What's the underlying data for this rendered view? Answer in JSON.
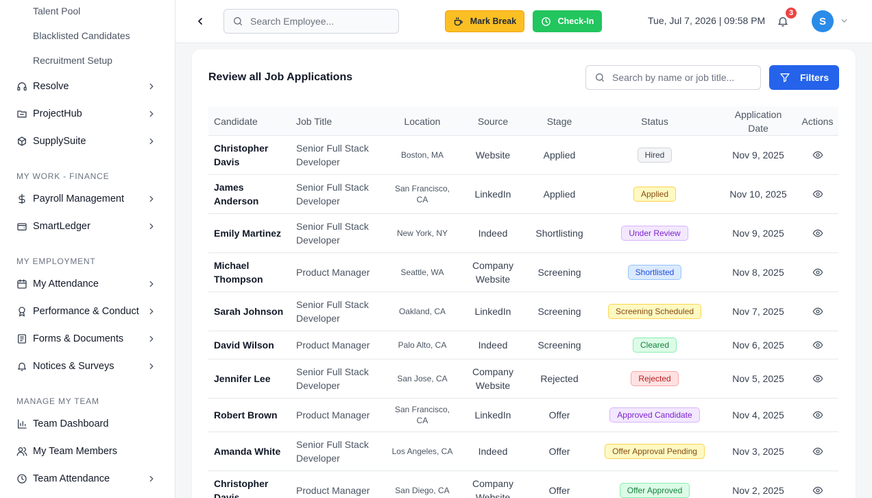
{
  "sidebar": {
    "sub_items": [
      "Talent Pool",
      "Blacklisted Candidates",
      "Recruitment Setup"
    ],
    "groups": [
      {
        "label": "Resolve",
        "icon": "headset-icon"
      },
      {
        "label": "ProjectHub",
        "icon": "folder-icon"
      },
      {
        "label": "SupplySuite",
        "icon": "box-icon"
      }
    ],
    "sections": [
      {
        "title": "MY WORK - FINANCE",
        "items": [
          {
            "label": "Payroll Management",
            "icon": "dollar-icon"
          },
          {
            "label": "SmartLedger",
            "icon": "wallet-icon"
          }
        ]
      },
      {
        "title": "MY EMPLOYMENT",
        "items": [
          {
            "label": "My Attendance",
            "icon": "calendar-icon"
          },
          {
            "label": "Performance & Conduct",
            "icon": "award-icon"
          },
          {
            "label": "Forms & Documents",
            "icon": "document-icon"
          },
          {
            "label": "Notices & Surveys",
            "icon": "bell-icon"
          }
        ]
      },
      {
        "title": "MANAGE MY TEAM",
        "items": [
          {
            "label": "Team Dashboard",
            "icon": "bar-chart-icon"
          },
          {
            "label": "My Team Members",
            "icon": "users-icon"
          },
          {
            "label": "Team Attendance",
            "icon": "clock-icon"
          }
        ]
      }
    ]
  },
  "topbar": {
    "search_placeholder": "Search Employee...",
    "mark_break_label": "Mark Break",
    "check_in_label": "Check-In",
    "datetime": "Tue, Jul 7, 2026 | 09:58 PM",
    "notification_count": "3",
    "avatar_initial": "S"
  },
  "main": {
    "title": "Review all Job Applications",
    "search_placeholder": "Search by name or job title...",
    "filters_label": "Filters",
    "columns": {
      "candidate": "Candidate",
      "job_title": "Job Title",
      "location": "Location",
      "source": "Source",
      "stage": "Stage",
      "status": "Status",
      "application_date": "Application Date",
      "actions": "Actions"
    },
    "rows": [
      {
        "candidate": "Christopher Davis",
        "job_title": "Senior Full Stack Developer",
        "location": "Boston, MA",
        "source": "Website",
        "stage": "Applied",
        "status": "Hired",
        "status_color": "gray",
        "date": "Nov 9, 2025"
      },
      {
        "candidate": "James Anderson",
        "job_title": "Senior Full Stack Developer",
        "location": "San Francisco, CA",
        "source": "LinkedIn",
        "stage": "Applied",
        "status": "Applied",
        "status_color": "yellow",
        "date": "Nov 10, 2025"
      },
      {
        "candidate": "Emily Martinez",
        "job_title": "Senior Full Stack Developer",
        "location": "New York, NY",
        "source": "Indeed",
        "stage": "Shortlisting",
        "status": "Under Review",
        "status_color": "purple",
        "date": "Nov 9, 2025"
      },
      {
        "candidate": "Michael Thompson",
        "job_title": "Product Manager",
        "location": "Seattle, WA",
        "source": "Company Website",
        "stage": "Screening",
        "status": "Shortlisted",
        "status_color": "blue",
        "date": "Nov 8, 2025"
      },
      {
        "candidate": "Sarah Johnson",
        "job_title": "Senior Full Stack Developer",
        "location": "Oakland, CA",
        "source": "LinkedIn",
        "stage": "Screening",
        "status": "Screening Scheduled",
        "status_color": "yellow",
        "date": "Nov 7, 2025"
      },
      {
        "candidate": "David Wilson",
        "job_title": "Product Manager",
        "location": "Palo Alto, CA",
        "source": "Indeed",
        "stage": "Screening",
        "status": "Cleared",
        "status_color": "green",
        "date": "Nov 6, 2025"
      },
      {
        "candidate": "Jennifer Lee",
        "job_title": "Senior Full Stack Developer",
        "location": "San Jose, CA",
        "source": "Company Website",
        "stage": "Rejected",
        "status": "Rejected",
        "status_color": "red",
        "date": "Nov 5, 2025"
      },
      {
        "candidate": "Robert Brown",
        "job_title": "Product Manager",
        "location": "San Francisco, CA",
        "source": "LinkedIn",
        "stage": "Offer",
        "status": "Approved Candidate",
        "status_color": "purple",
        "date": "Nov 4, 2025"
      },
      {
        "candidate": "Amanda White",
        "job_title": "Senior Full Stack Developer",
        "location": "Los Angeles, CA",
        "source": "Indeed",
        "stage": "Offer",
        "status": "Offer Approval Pending",
        "status_color": "yellow",
        "date": "Nov 3, 2025"
      },
      {
        "candidate": "Christopher Davis",
        "job_title": "Product Manager",
        "location": "San Diego, CA",
        "source": "Company Website",
        "stage": "Offer",
        "status": "Offer Approved",
        "status_color": "green",
        "date": "Nov 2, 2025"
      }
    ]
  },
  "colors": {
    "primary": "#2563eb",
    "break": "#fbbf24",
    "checkin": "#22c55e",
    "avatar": "#2a8be8",
    "badge_alert": "#ef4444"
  }
}
